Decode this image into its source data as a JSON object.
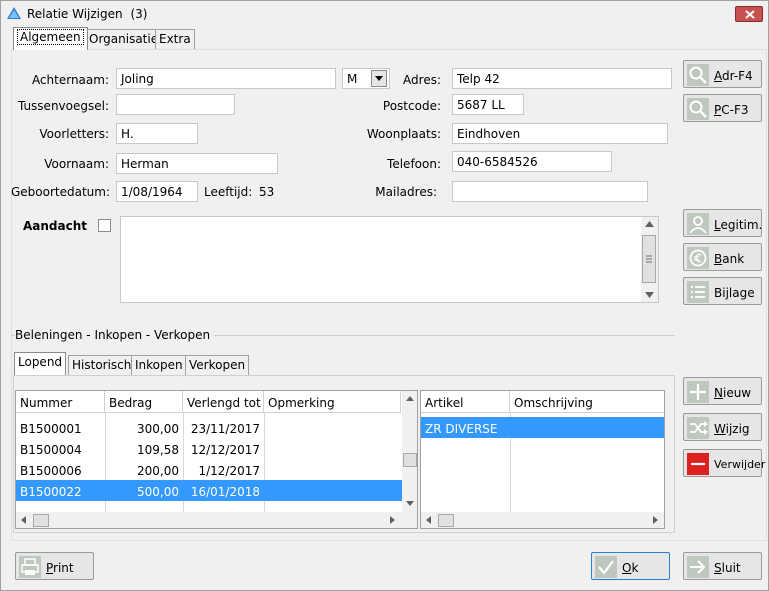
{
  "window": {
    "title": "Relatie Wijzigen",
    "count": "(3)"
  },
  "tabs": [
    "Algemeen",
    "Organisatie",
    "Extra"
  ],
  "form": {
    "achternaam": {
      "label": "Achternaam:",
      "value": "Joling"
    },
    "geslacht": {
      "value": "M"
    },
    "tussenvoegsel": {
      "label": "Tussenvoegsel:",
      "value": ""
    },
    "voorletters": {
      "label": "Voorletters:",
      "value": "H."
    },
    "voornaam": {
      "label": "Voornaam:",
      "value": "Herman"
    },
    "geboortedatum": {
      "label": "Geboortedatum:",
      "value": "1/08/1964"
    },
    "leeftijd": {
      "label": "Leeftijd:",
      "value": "53"
    },
    "adres": {
      "label": "Adres:",
      "value": "Telp 42"
    },
    "postcode": {
      "label": "Postcode:",
      "value": "5687 LL"
    },
    "woonplaats": {
      "label": "Woonplaats:",
      "value": "Eindhoven"
    },
    "telefoon": {
      "label": "Telefoon:",
      "value": "040-6584526"
    },
    "mailadres": {
      "label": "Mailadres:",
      "value": ""
    },
    "aandacht": {
      "label": "Aandacht",
      "checked": false,
      "text": ""
    }
  },
  "side_buttons": {
    "adr": {
      "prefix": "A",
      "rest": "dr-F4"
    },
    "pc": {
      "prefix": "P",
      "rest": "C-F3"
    },
    "legitim": {
      "prefix": "L",
      "rest": "egitim."
    },
    "bank": {
      "prefix": "B",
      "rest": "ank"
    },
    "bijlage": {
      "prefix": "Bi",
      "u": "j",
      "rest": "lage"
    }
  },
  "section": {
    "title": "Beleningen - Inkopen - Verkopen"
  },
  "subtabs": [
    "Lopend",
    "Historisch",
    "Inkopen",
    "Verkopen"
  ],
  "main_grid": {
    "columns": [
      "Nummer",
      "Bedrag",
      "Verlengd tot",
      "Opmerking"
    ],
    "rows": [
      {
        "nummer": "B1500001",
        "bedrag": "300,00",
        "verlengd": "23/11/2017",
        "opmerking": ""
      },
      {
        "nummer": "B1500004",
        "bedrag": "109,58",
        "verlengd": "12/12/2017",
        "opmerking": ""
      },
      {
        "nummer": "B1500006",
        "bedrag": "200,00",
        "verlengd": "1/12/2017",
        "opmerking": ""
      },
      {
        "nummer": "B1500022",
        "bedrag": "500,00",
        "verlengd": "16/01/2018",
        "opmerking": "",
        "selected": true
      }
    ]
  },
  "detail_grid": {
    "columns": [
      "Artikel",
      "Omschrijving"
    ],
    "rows": [
      {
        "artikel": "ZR DIVERSE",
        "omschrijving": "",
        "selected": true
      }
    ]
  },
  "action_buttons": {
    "nieuw": {
      "prefix": "N",
      "rest": "ieuw"
    },
    "wijzig": {
      "prefix": "W",
      "rest": "ijzig"
    },
    "verwijder": {
      "label": "Verwijder"
    }
  },
  "footer": {
    "print": {
      "prefix": "P",
      "rest": "rint"
    },
    "ok": {
      "prefix": "O",
      "rest": "k"
    },
    "sluit": {
      "prefix": "S",
      "rest": "luit"
    }
  },
  "colors": {
    "selection": "#3399ff",
    "delete": "#e02020",
    "close": "#c75050"
  }
}
